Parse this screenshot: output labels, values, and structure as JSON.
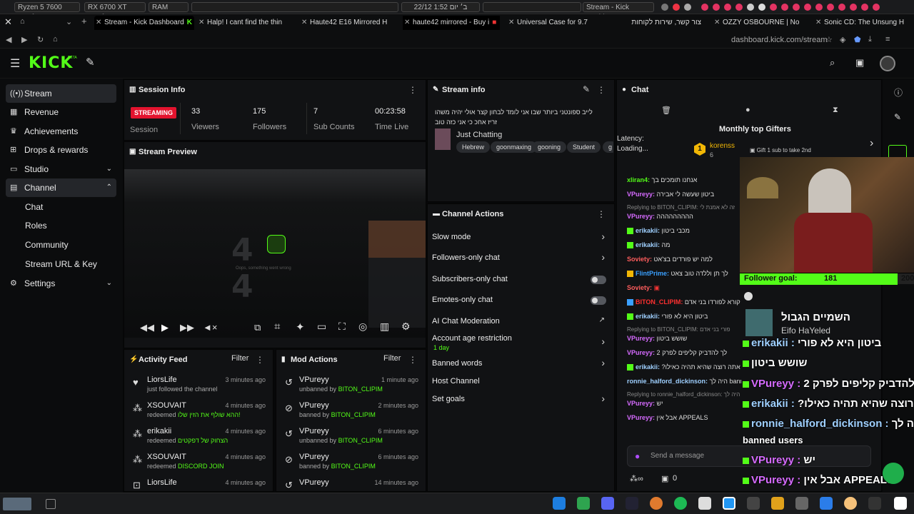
{
  "system": {
    "cpu": "Ryzen 5 7600  74.4°C",
    "gpu": "RX 6700 XT 51.0°C",
    "ram": "RAM  59.2%",
    "datetime": "22/12 ב׳ יום 1:52",
    "window_title": "Stream - Kick Dashboa..."
  },
  "tabs": [
    {
      "label": "Stream - Kick Dashboard"
    },
    {
      "label": "Halp! I cant find the thin"
    },
    {
      "label": "Haute42 E16 Mirrored H"
    },
    {
      "label": "haute42 mirrored - Buy i"
    },
    {
      "label": "Universal Case for 9.7"
    },
    {
      "label": "צור קשר, שירות לקוחות"
    },
    {
      "label": "OZZY OSBOURNE | No"
    },
    {
      "label": "Sonic CD: The Unsung H"
    }
  ],
  "url": "dashboard.kick.com/stream",
  "brand": {
    "logo": "KICK",
    "beta": "BETA",
    "accent": "#53fc18"
  },
  "sidebar": {
    "items": [
      {
        "label": "Stream",
        "icon": "broadcast-icon"
      },
      {
        "label": "Revenue",
        "icon": "revenue-icon"
      },
      {
        "label": "Achievements",
        "icon": "trophy-icon"
      },
      {
        "label": "Drops & rewards",
        "icon": "gift-icon"
      },
      {
        "label": "Studio",
        "icon": "studio-icon"
      },
      {
        "label": "Channel",
        "icon": "channel-icon"
      },
      {
        "label": "Settings",
        "icon": "gear-icon"
      }
    ],
    "channel_sub": [
      "Chat",
      "Roles",
      "Community",
      "Stream URL & Key"
    ]
  },
  "session": {
    "title": "Session Info",
    "status": "STREAMING",
    "session_label": "Session",
    "stats": [
      {
        "value": "33",
        "label": "Viewers"
      },
      {
        "value": "175",
        "label": "Followers"
      },
      {
        "value": "7",
        "label": "Sub Counts"
      },
      {
        "value": "00:23:58",
        "label": "Time Live"
      }
    ]
  },
  "preview": {
    "title": "Stream Preview",
    "error_text": "Oops, something went wrong"
  },
  "stream_info": {
    "title": "Stream info",
    "stream_title": "לייב ספונטני ביותר שבו אני לומד לבחון קצר אולי יהיה משהו זריז אחכ כי אני כזה טוב",
    "category": "Just Chatting",
    "tags": [
      "Hebrew",
      "goonmaxing",
      "gooning",
      "Student",
      "g"
    ]
  },
  "channel_actions": {
    "title": "Channel Actions",
    "rows": [
      {
        "label": "Slow mode",
        "type": "chevron"
      },
      {
        "label": "Followers-only chat",
        "type": "chevron"
      },
      {
        "label": "Subscribers-only chat",
        "type": "toggle"
      },
      {
        "label": "Emotes-only chat",
        "type": "toggle"
      },
      {
        "label": "AI Chat Moderation",
        "type": "external"
      },
      {
        "label": "Account age restriction",
        "sub": "1 day",
        "type": "chevron"
      },
      {
        "label": "Banned words",
        "type": "chevron"
      },
      {
        "label": "Host Channel",
        "type": "none"
      },
      {
        "label": "Set goals",
        "type": "chevron"
      }
    ]
  },
  "activity": {
    "title": "Activity Feed",
    "filter": "Filter",
    "rows": [
      {
        "name": "LiorsLife",
        "sub": "just followed the channel",
        "highlight": "",
        "time": "3 minutes ago"
      },
      {
        "name": "XSOUVAIT",
        "sub": "redeemed",
        "highlight": "ההא שולף את הזין שלו!",
        "time": "4 minutes ago"
      },
      {
        "name": "erikakii",
        "sub": "redeemed",
        "highlight": "הצחוק של דפקטים",
        "time": "4 minutes ago"
      },
      {
        "name": "XSOUVAIT",
        "sub": "redeemed",
        "highlight": "DISCORD JOIN",
        "time": "4 minutes ago"
      },
      {
        "name": "LiorsLife",
        "sub": "",
        "highlight": "",
        "time": "4 minutes ago"
      }
    ]
  },
  "mod_actions": {
    "title": "Mod Actions",
    "filter": "Filter",
    "rows": [
      {
        "name": "VPureyy",
        "sub": "unbanned by",
        "by": "BITON_CLIPIM",
        "time": "1 minute ago"
      },
      {
        "name": "VPureyy",
        "sub": "banned by",
        "by": "BITON_CLIPIM",
        "time": "2 minutes ago"
      },
      {
        "name": "VPureyy",
        "sub": "unbanned by",
        "by": "BITON_CLIPIM",
        "time": "6 minutes ago"
      },
      {
        "name": "VPureyy",
        "sub": "banned by",
        "by": "BITON_CLIPIM",
        "time": "6 minutes ago"
      },
      {
        "name": "VPureyy",
        "sub": "",
        "by": "",
        "time": "14 minutes ago"
      }
    ]
  },
  "chat": {
    "title": "Chat",
    "gifters_title": "Monthly top Gifters",
    "top_gifter": {
      "rank": "1",
      "name": "korenss",
      "count": "6"
    },
    "gift_text": "Gift 1 sub to take 2nd",
    "latency": "Latency:",
    "loading": "Loading...",
    "lines": [
      {
        "name": "xliran4:",
        "text": "אנחנו תומכים בך",
        "color": "#53fc18"
      },
      {
        "name": "VPureyy:",
        "text": "ביטון שעשה לי אבירה",
        "color": "#d66bff"
      },
      {
        "name": "",
        "text": "Replying to BITON_CLIPIM: זה לא אמנת לי",
        "color": "#888"
      },
      {
        "name": "VPureyy:",
        "text": "ההההההההה",
        "color": "#d66bff"
      },
      {
        "name": "erikakii:",
        "text": "מכבי ביטון",
        "color": "#9fd0ff"
      },
      {
        "name": "erikakii:",
        "text": "מה",
        "color": "#9fd0ff"
      },
      {
        "name": "Soviety:",
        "text": "למה יש פורדים בצ'אט",
        "color": "#ff5d5d"
      },
      {
        "name": "FlintPrime:",
        "text": "לך תן וללדה טוב צאט",
        "color": "#3aa0ff"
      },
      {
        "name": "Soviety:",
        "text": "",
        "color": "#ff5d5d"
      },
      {
        "name": "BITON_CLIPIM:",
        "text": "קורא לפורדו בני אדם",
        "color": "#ff3030"
      },
      {
        "name": "erikakii:",
        "text": "ביטון היא לא פורי",
        "color": "#9fd0ff"
      },
      {
        "name": "",
        "text": "Replying to BITON_CLIPIM: פורי בני אדם",
        "color": "#888"
      },
      {
        "name": "VPureyy:",
        "text": "שושש ביטון",
        "color": "#d66bff"
      },
      {
        "name": "VPureyy:",
        "text": "לך להדביק קליפים לפרק 2",
        "color": "#d66bff"
      },
      {
        "name": "erikakii:",
        "text": "?אתה רוצה שהיא תהיה כאילו",
        "color": "#9fd0ff"
      },
      {
        "name": "ronnie_halford_dickinson:",
        "text": "היה לך banned users",
        "color": "#9fd0ff"
      },
      {
        "name": "",
        "text": "Replying to ronnie_halford_dickinson: היה לך banned users",
        "color": "#888"
      },
      {
        "name": "VPureyy:",
        "text": "יש",
        "color": "#d66bff"
      },
      {
        "name": "VPureyy:",
        "text": "אבל אין APPEALS",
        "color": "#d66bff"
      }
    ],
    "placeholder": "Send a message",
    "footer_count": "0"
  },
  "overlay": {
    "goal_label": "Follower goal:",
    "goal_value": "181",
    "goal_target": "200",
    "goal_progress": 0.905,
    "song": "השמיים הגבול",
    "artist": "Eifo HaYeled",
    "lines": [
      {
        "name": "erikakii :",
        "text": "ביטון היא לא פורי",
        "color": "#9fd0ff"
      },
      {
        "name": "",
        "text": "שושש ביטון",
        "color": "#fff"
      },
      {
        "name": "VPureyy :",
        "text": "לך להדביק קליפים לפרק 2",
        "color": "#d66bff"
      },
      {
        "name": "erikakii :",
        "text": "?אתה רוצה שהיא תהיה כאילו",
        "color": "#9fd0ff"
      },
      {
        "name": "ronnie_halford_dickinson :",
        "text": "היה לך",
        "color": "#9fd0ff"
      },
      {
        "name": "",
        "text": "banned users",
        "color": "#fff"
      },
      {
        "name": "VPureyy :",
        "text": "יש",
        "color": "#d66bff"
      },
      {
        "name": "VPureyy :",
        "text": "אבל אין APPEALS",
        "color": "#d66bff"
      }
    ]
  }
}
